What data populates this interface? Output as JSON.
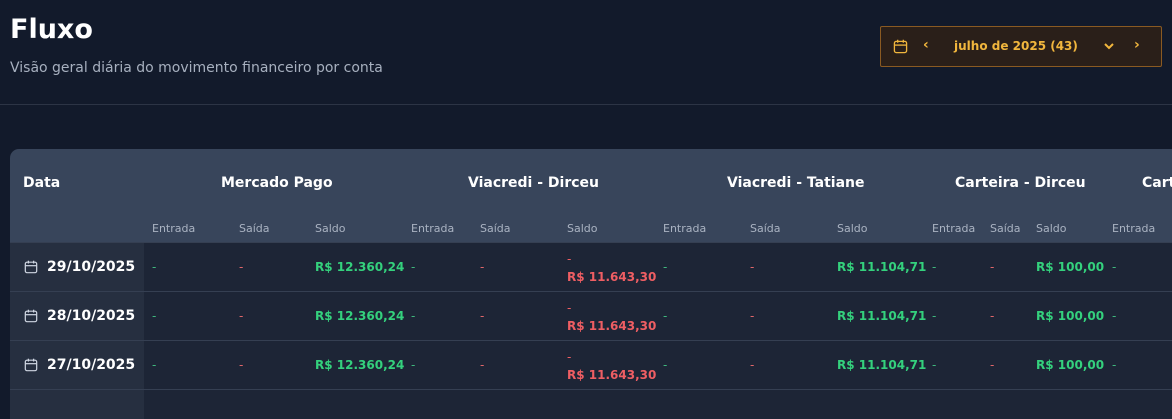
{
  "page": {
    "title": "Fluxo",
    "subtitle": "Visão geral diária do movimento financeiro por conta"
  },
  "period": {
    "label": "julho de 2025 (43)",
    "prev_icon": "chevron-left-icon",
    "next_icon": "chevron-right-icon",
    "calendar_icon": "calendar-icon",
    "dropdown_icon": "chevron-down-icon"
  },
  "colors": {
    "accent": "#f1b63d",
    "positive": "#34d17d",
    "negative": "#ef5e63",
    "background": "#121a2b",
    "header": "#38455b"
  },
  "table": {
    "date_header": "Data",
    "accounts": [
      "Mercado Pago",
      "Viacredi - Dirceu",
      "Viacredi - Tatiane",
      "Carteira - Dirceu",
      "Cart"
    ],
    "subheaders": {
      "entrada": "Entrada",
      "saida": "Saída",
      "saldo": "Saldo"
    },
    "dash": "-",
    "rows": [
      {
        "date": "29/10/2025",
        "mp_entrada": "-",
        "mp_saida": "-",
        "mp_saldo": "R$ 12.360,24",
        "vd_entrada": "-",
        "vd_saida": "-",
        "vd_saldo_sign": "-",
        "vd_saldo": "R$ 11.643,30",
        "vt_entrada": "-",
        "vt_saida": "-",
        "vt_saldo": "R$ 11.104,71",
        "cd_entrada": "-",
        "cd_saida": "-",
        "cd_saldo": "R$ 100,00",
        "c2_entrada": "-"
      },
      {
        "date": "28/10/2025",
        "mp_entrada": "-",
        "mp_saida": "-",
        "mp_saldo": "R$ 12.360,24",
        "vd_entrada": "-",
        "vd_saida": "-",
        "vd_saldo_sign": "-",
        "vd_saldo": "R$ 11.643,30",
        "vt_entrada": "-",
        "vt_saida": "-",
        "vt_saldo": "R$ 11.104,71",
        "cd_entrada": "-",
        "cd_saida": "-",
        "cd_saldo": "R$ 100,00",
        "c2_entrada": "-"
      },
      {
        "date": "27/10/2025",
        "mp_entrada": "-",
        "mp_saida": "-",
        "mp_saldo": "R$ 12.360,24",
        "vd_entrada": "-",
        "vd_saida": "-",
        "vd_saldo_sign": "-",
        "vd_saldo": "R$ 11.643,30",
        "vt_entrada": "-",
        "vt_saida": "-",
        "vt_saldo": "R$ 11.104,71",
        "cd_entrada": "-",
        "cd_saida": "-",
        "cd_saldo": "R$ 100,00",
        "c2_entrada": "-"
      }
    ]
  }
}
